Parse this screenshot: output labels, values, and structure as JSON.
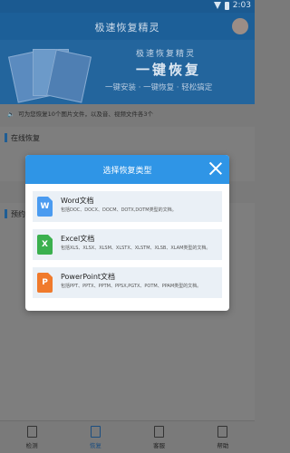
{
  "status_bar": {
    "time": "2:03"
  },
  "app_bar": {
    "title": "极速恢复精灵"
  },
  "banner": {
    "line1": "极速恢复精灵",
    "line2": "一键恢复",
    "line3": "一键安装 · 一键恢复 · 轻松搞定"
  },
  "notice": {
    "text": "可为您恢复10个图片文件，以及音、视频文件各3个"
  },
  "sections": {
    "online": "在线恢复",
    "pre": "预约"
  },
  "modal": {
    "title": "选择恢复类型",
    "options": [
      {
        "name": "Word文档",
        "desc": "包括DOC、DOCX、DOCM、DOTX,DOTM类型的文档。",
        "badge": "W",
        "color": "#4a9bf0"
      },
      {
        "name": "Excel文档",
        "desc": "包括XLS、XLSX、XLSM、XLSTX、XLSTM、XLSB、XLAM类型的文档。",
        "badge": "X",
        "color": "#3bb04e"
      },
      {
        "name": "PowerPoint文档",
        "desc": "包括PPT、PPTX、PPTM、PPSX,PGTX、POTM、PPAM类型的文档。",
        "badge": "P",
        "color": "#f07a2c"
      }
    ]
  },
  "bottom_nav": [
    {
      "label": "检测"
    },
    {
      "label": "恢复"
    },
    {
      "label": "客服"
    },
    {
      "label": "帮助"
    }
  ]
}
